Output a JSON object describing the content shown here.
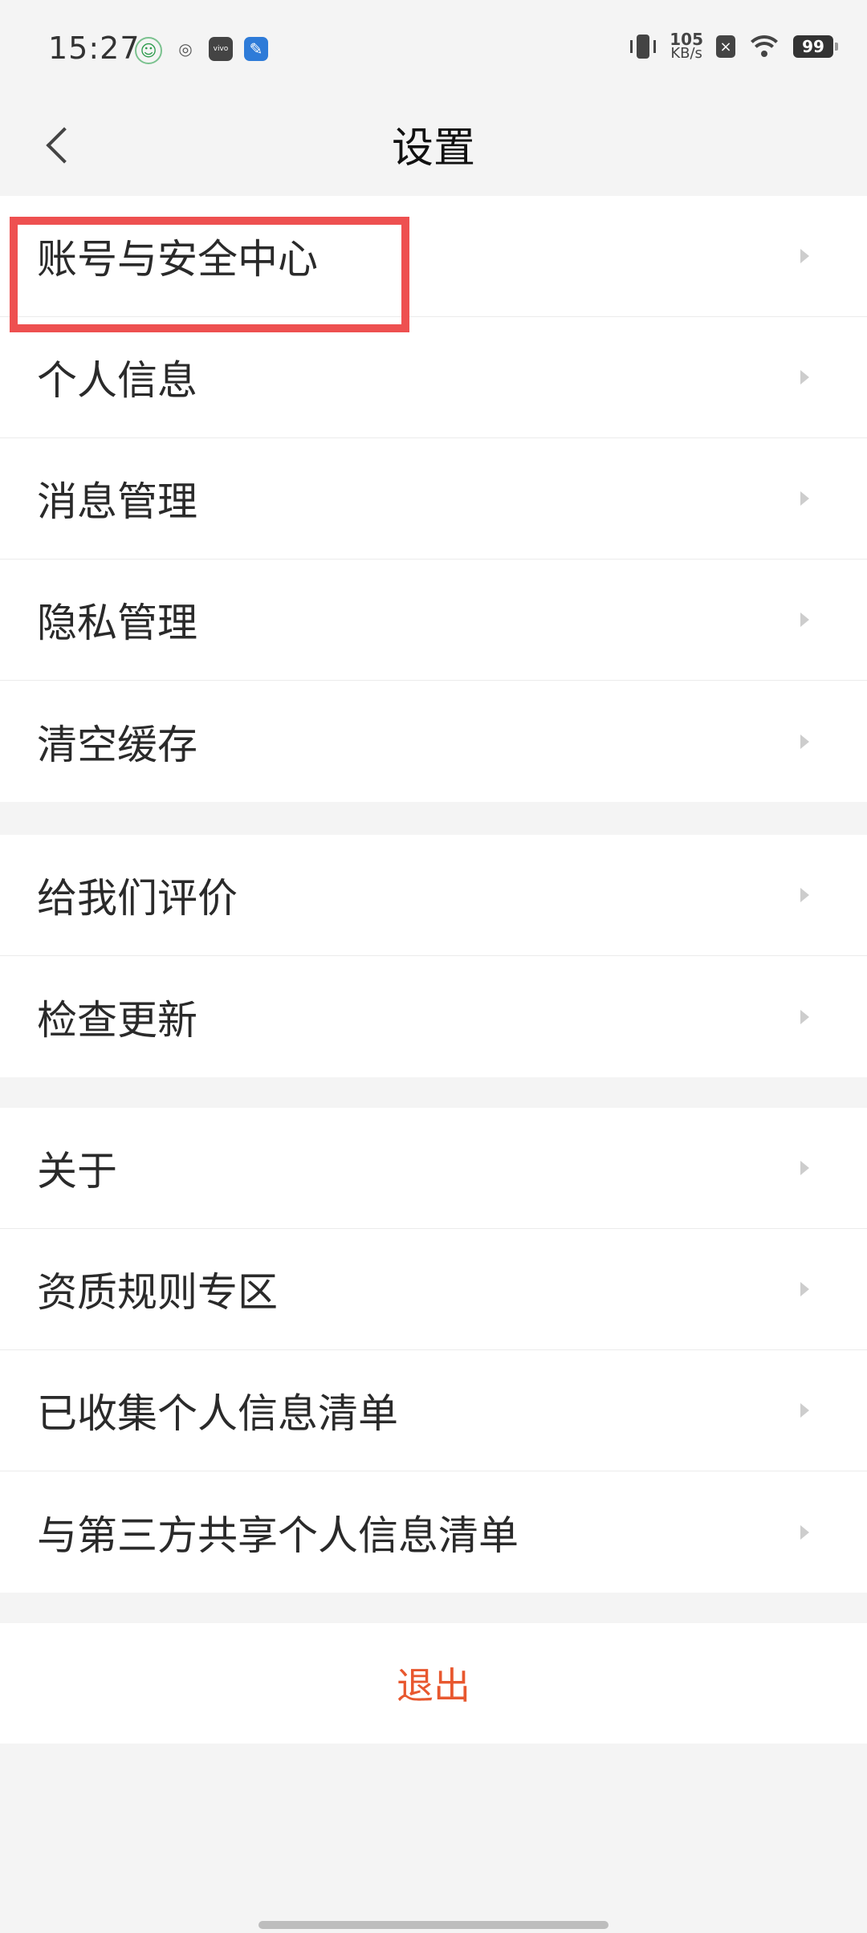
{
  "status_bar": {
    "time": "15:27",
    "left_icons": [
      "qq-icon",
      "browser-icon",
      "vivo-icon",
      "pen-app-icon"
    ],
    "vivo_label": "vivo",
    "net_speed_value": "105",
    "net_speed_unit": "KB/s",
    "sim_label": "×",
    "battery": "99"
  },
  "header": {
    "title": "设置"
  },
  "sections": [
    {
      "items": [
        {
          "label": "账号与安全中心"
        },
        {
          "label": "个人信息"
        },
        {
          "label": "消息管理"
        },
        {
          "label": "隐私管理"
        },
        {
          "label": "清空缓存"
        }
      ]
    },
    {
      "items": [
        {
          "label": "给我们评价"
        },
        {
          "label": "检查更新"
        }
      ]
    },
    {
      "items": [
        {
          "label": "关于"
        },
        {
          "label": "资质规则专区"
        },
        {
          "label": "已收集个人信息清单"
        },
        {
          "label": "与第三方共享个人信息清单"
        }
      ]
    }
  ],
  "logout": {
    "label": "退出"
  },
  "colors": {
    "background": "#f4f4f4",
    "accent": "#e8582f",
    "highlight": "#ee5050"
  }
}
